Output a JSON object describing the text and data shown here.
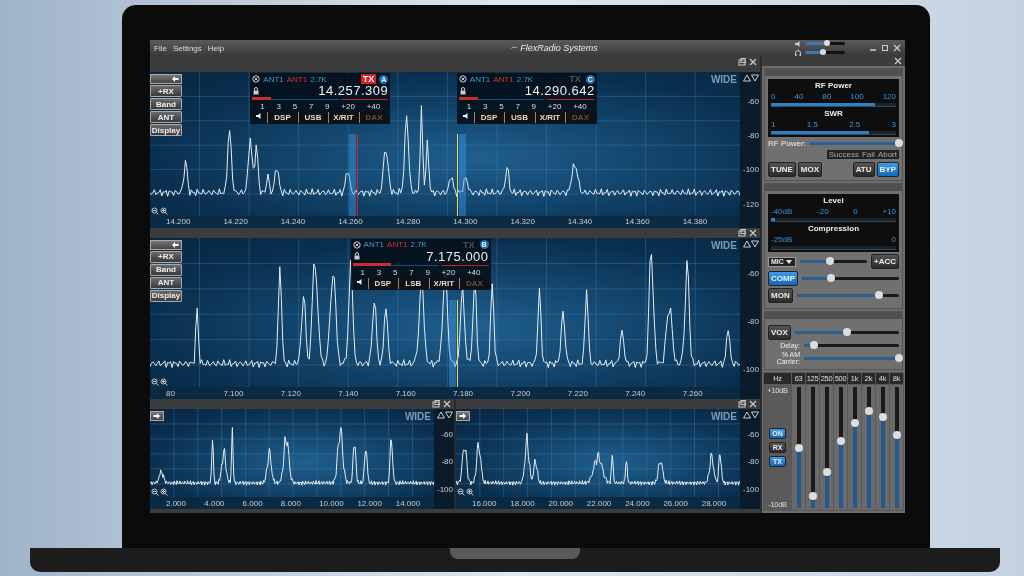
{
  "menu": {
    "items": [
      "File",
      "Settings",
      "Help"
    ],
    "logo": "FlexRadio Systems",
    "volume": {
      "level": 0.55
    },
    "headphones": {
      "level": 0.45
    }
  },
  "panadapters": [
    {
      "kind": "full",
      "buttons": [
        "+RX",
        "Band",
        "ANT",
        "Display"
      ],
      "mode": "WIDE",
      "db_labels": [
        "-60",
        "-80",
        "-100",
        "-120"
      ],
      "freq_labels": [
        "14.200",
        "14.220",
        "14.240",
        "14.260",
        "14.280",
        "14.300",
        "14.320",
        "14.340",
        "14.360",
        "14.380"
      ],
      "slices": [
        {
          "letter": "A",
          "ant_rx": "ANT1",
          "ant_tx": "ANT1",
          "filter": "2.7K",
          "tx_label": "TX",
          "tx": true,
          "frequency": "14.257.309",
          "level": 0.22,
          "scale": [
            "1",
            "3",
            "5",
            "7",
            "9",
            "+20",
            "+40"
          ],
          "buttons": [
            {
              "label": "DSP",
              "disabled": false
            },
            {
              "label": "USB",
              "disabled": false
            },
            {
              "label": "X/RIT",
              "disabled": false
            },
            {
              "label": "DAX",
              "disabled": true
            }
          ]
        },
        {
          "letter": "C",
          "ant_rx": "ANT1",
          "ant_tx": "ANT1",
          "filter": "2.7K",
          "tx_label": "TX",
          "tx": false,
          "frequency": "14.290.642",
          "level": 0.22,
          "scale": [
            "1",
            "3",
            "5",
            "7",
            "9",
            "+20",
            "+40"
          ],
          "buttons": [
            {
              "label": "DSP",
              "disabled": false
            },
            {
              "label": "USB",
              "disabled": false
            },
            {
              "label": "X/RIT",
              "disabled": false
            },
            {
              "label": "DAX",
              "disabled": true
            }
          ]
        }
      ]
    },
    {
      "kind": "full",
      "buttons": [
        "+RX",
        "Band",
        "ANT",
        "Display"
      ],
      "mode": "WIDE",
      "db_labels": [
        "-60",
        "-80",
        "-100"
      ],
      "freq_labels": [
        "80",
        "7.100",
        "7.120",
        "7.140",
        "7.160",
        "7.180",
        "7.200",
        "7.220",
        "7.240",
        "7.260"
      ],
      "slices": [
        {
          "letter": "B",
          "ant_rx": "ANT1",
          "ant_tx": "ANT1",
          "filter": "2.7K",
          "tx_label": "TX",
          "tx": false,
          "frequency": "7.175.000",
          "level": 0.45,
          "scale": [
            "1",
            "3",
            "5",
            "7",
            "9",
            "+20",
            "+40"
          ],
          "buttons": [
            {
              "label": "DSP",
              "disabled": false
            },
            {
              "label": "LSB",
              "disabled": false
            },
            {
              "label": "X/RIT",
              "disabled": false
            },
            {
              "label": "DAX",
              "disabled": true
            }
          ]
        }
      ]
    },
    {
      "kind": "mini",
      "mode": "WIDE",
      "db_labels": [
        "-60",
        "-80",
        "-100"
      ],
      "freq_labels": [
        "2.000",
        "4.000",
        "6.000",
        "8.000",
        "10.000",
        "12.000",
        "14.000"
      ]
    },
    {
      "kind": "mini",
      "mode": "WIDE",
      "db_labels": [
        "-60",
        "-80",
        "-100"
      ],
      "freq_labels": [
        "16.000",
        "18.000",
        "20.000",
        "22.000",
        "24.000",
        "26.000",
        "28.000"
      ]
    }
  ],
  "tx_panel": {
    "meters": [
      {
        "title": "RF Power",
        "scale": [
          "0",
          "40",
          "80",
          "100",
          "120"
        ],
        "level": 0.83
      },
      {
        "title": "SWR",
        "scale": [
          "1",
          "1.5",
          "2.5",
          "3"
        ],
        "level": 0.78
      }
    ],
    "rf_power_label": "RF Power:",
    "rf_power": {
      "level": 1.0
    },
    "tune_status": [
      "Success",
      "Fail",
      "Abort"
    ],
    "buttons": [
      {
        "label": "TUNE",
        "selected": false
      },
      {
        "label": "MOX",
        "selected": false
      },
      {
        "label": "ATU",
        "selected": false
      },
      {
        "label": "BYP",
        "selected": true
      }
    ]
  },
  "phone_panel": {
    "meters": [
      {
        "title": "Level",
        "scale": [
          "-40dB",
          "-20",
          "0",
          "+10"
        ],
        "level": 0.03
      },
      {
        "title": "Compression",
        "scale": [
          "-25dB",
          "0"
        ]
      }
    ],
    "controls": [
      {
        "kind": "dropdown",
        "label": "MIC",
        "level": 0.45,
        "extra": "+ACC"
      },
      {
        "kind": "toggle",
        "label": "COMP",
        "selected": true,
        "level": 0.3
      },
      {
        "kind": "toggle",
        "label": "MON",
        "selected": false,
        "level": 0.8
      }
    ]
  },
  "vox_panel": {
    "controls": [
      {
        "kind": "toggle",
        "label": "VOX",
        "selected": false,
        "level": 0.5
      },
      {
        "kind": "label",
        "label": "Delay:",
        "level": 0.1
      },
      {
        "kind": "label",
        "label": "% AM Carrier:",
        "level": 1.0
      }
    ]
  },
  "equalizer": {
    "unit": "Hz",
    "top": "+10dB",
    "bottom": "-10dB",
    "bands": [
      {
        "label": "63",
        "level": 0.5
      },
      {
        "label": "125",
        "level": 0.1
      },
      {
        "label": "250",
        "level": 0.3
      },
      {
        "label": "500",
        "level": 0.55
      },
      {
        "label": "1k",
        "level": 0.7
      },
      {
        "label": "2k",
        "level": 0.8
      },
      {
        "label": "4k",
        "level": 0.75
      },
      {
        "label": "8k",
        "level": 0.6
      }
    ],
    "buttons": [
      {
        "label": "ON",
        "selected": true
      },
      {
        "label": "RX",
        "selected": false
      },
      {
        "label": "TX",
        "selected": true
      }
    ]
  }
}
